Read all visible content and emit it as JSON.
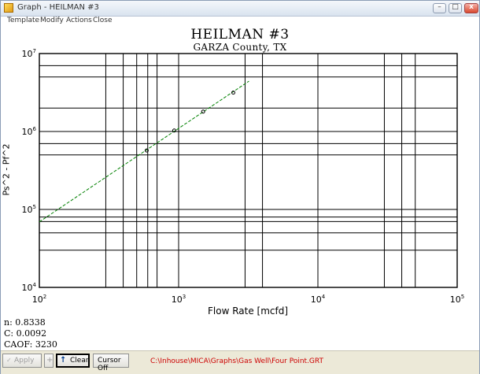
{
  "window": {
    "title": "Graph - HEILMAN #3",
    "buttons": {
      "minimize": "–",
      "maximize": "□",
      "close": "x"
    }
  },
  "menu": [
    "Template",
    "Modify",
    "Actions",
    "Close"
  ],
  "chart_data": {
    "type": "scatter",
    "title": "HEILMAN #3",
    "subtitle": "GARZA County, TX",
    "xlabel": "Flow Rate [mcfd]",
    "ylabel": "Ps^2 - Pf^2",
    "xscale": "log",
    "yscale": "log",
    "xlim": [
      100,
      100000
    ],
    "ylim": [
      10000,
      10000000
    ],
    "x_ticks": [
      {
        "base": "10",
        "exp": "2"
      },
      {
        "base": "10",
        "exp": "3"
      },
      {
        "base": "10",
        "exp": "4"
      },
      {
        "base": "10",
        "exp": "5"
      }
    ],
    "y_ticks": [
      {
        "base": "10",
        "exp": "4"
      },
      {
        "base": "10",
        "exp": "5"
      },
      {
        "base": "10",
        "exp": "6"
      },
      {
        "base": "10",
        "exp": "7"
      }
    ],
    "x_grid": [
      300,
      400,
      500,
      600,
      700,
      3000,
      4000,
      30000,
      40000,
      50000
    ],
    "y_grid": [
      30000,
      50000,
      70000,
      80000,
      500000,
      700000,
      2000000,
      5000000,
      7000000
    ],
    "points": [
      {
        "x": 590,
        "y": 570000
      },
      {
        "x": 930,
        "y": 1030000
      },
      {
        "x": 1500,
        "y": 1800000
      },
      {
        "x": 2470,
        "y": 3150000
      }
    ],
    "fit_line": {
      "n": 0.8338,
      "C": 0.0092,
      "x_range": [
        100,
        3200
      ]
    },
    "series_colors": {
      "points": "#000000",
      "fit_line": "#008000"
    }
  },
  "stats": {
    "n": "n: 0.8338",
    "c": "C: 0.0092",
    "caof": "CAOF:  3230"
  },
  "toolbar": {
    "apply": "Apply",
    "plus": "+",
    "clear": "Clear",
    "cursor_off": "Cursor Off",
    "file_path": "C:\\Inhouse\\MICA\\Graphs\\Gas Well\\Four Point.GRT"
  }
}
